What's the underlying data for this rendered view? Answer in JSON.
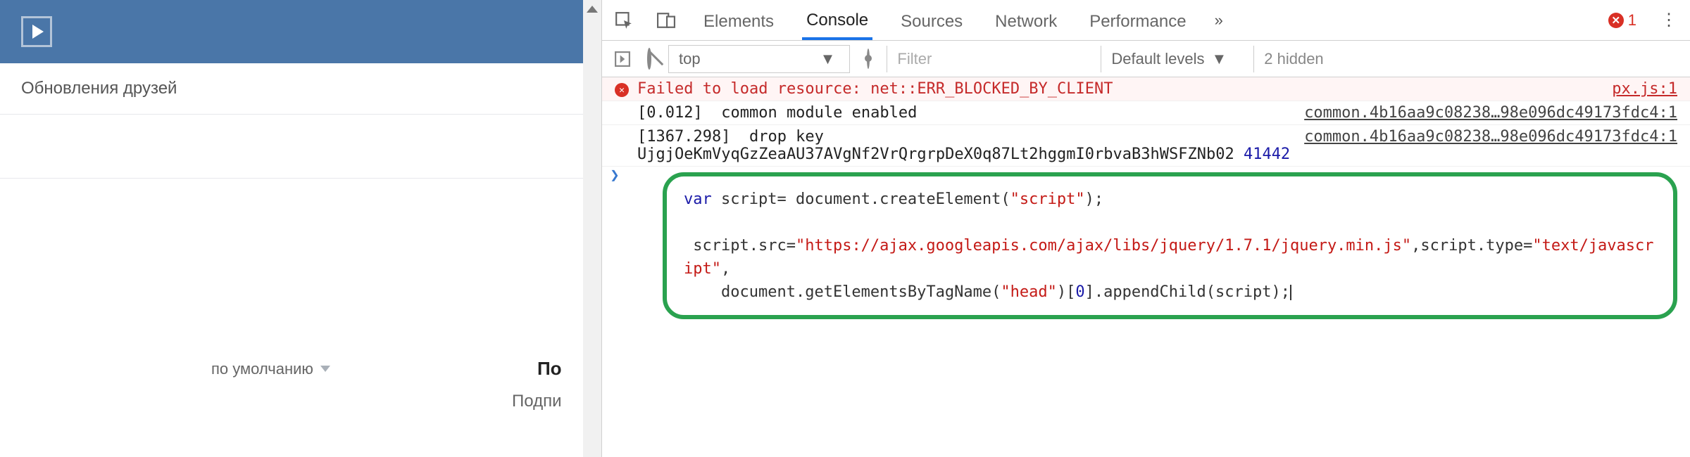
{
  "vk": {
    "feed_title": "Обновления друзей",
    "sort_label": "по умолчанию",
    "cut_heading": "По",
    "cut_sub": "Подпи"
  },
  "devtools": {
    "tabs": {
      "elements": "Elements",
      "console": "Console",
      "sources": "Sources",
      "network": "Network",
      "performance": "Performance"
    },
    "error_badge_count": "1",
    "toolbar": {
      "context": "top",
      "filter_placeholder": "Filter",
      "levels_label": "Default levels",
      "hidden_label": "2 hidden"
    },
    "logs": {
      "err_msg": "Failed to load resource: net::ERR_BLOCKED_BY_CLIENT",
      "err_src": "px.js:1",
      "info1_msg": "[0.012]  common module enabled",
      "info1_src": "common.4b16aa9c08238…98e096dc49173fdc4:1",
      "info2_line1": "[1367.298]  drop key",
      "info2_line2": "UjgjOeKmVyqGzZeaAU37AVgNf2VrQrgrpDeX0q87Lt2hggmI0rbvaB3hWSFZNb02 ",
      "info2_num": "41442",
      "info2_src": "common.4b16aa9c08238…98e096dc49173fdc4:1"
    },
    "code": {
      "l1_a": "var",
      "l1_b": " script= document.createElement(",
      "l1_c": "\"script\"",
      "l1_d": ");",
      "l3_a": " script.src=",
      "l3_b": "\"https://ajax.googleapis.com/ajax/libs/jquery/1.7.1/jquery.min.js\"",
      "l3_c": ",script.type=",
      "l3_d": "\"text/javascript\"",
      "l3_e": ",",
      "l4_a": "    document.getElementsByTagName(",
      "l4_b": "\"head\"",
      "l4_c": ")[",
      "l4_d": "0",
      "l4_e": "].appendChild(script);"
    }
  }
}
